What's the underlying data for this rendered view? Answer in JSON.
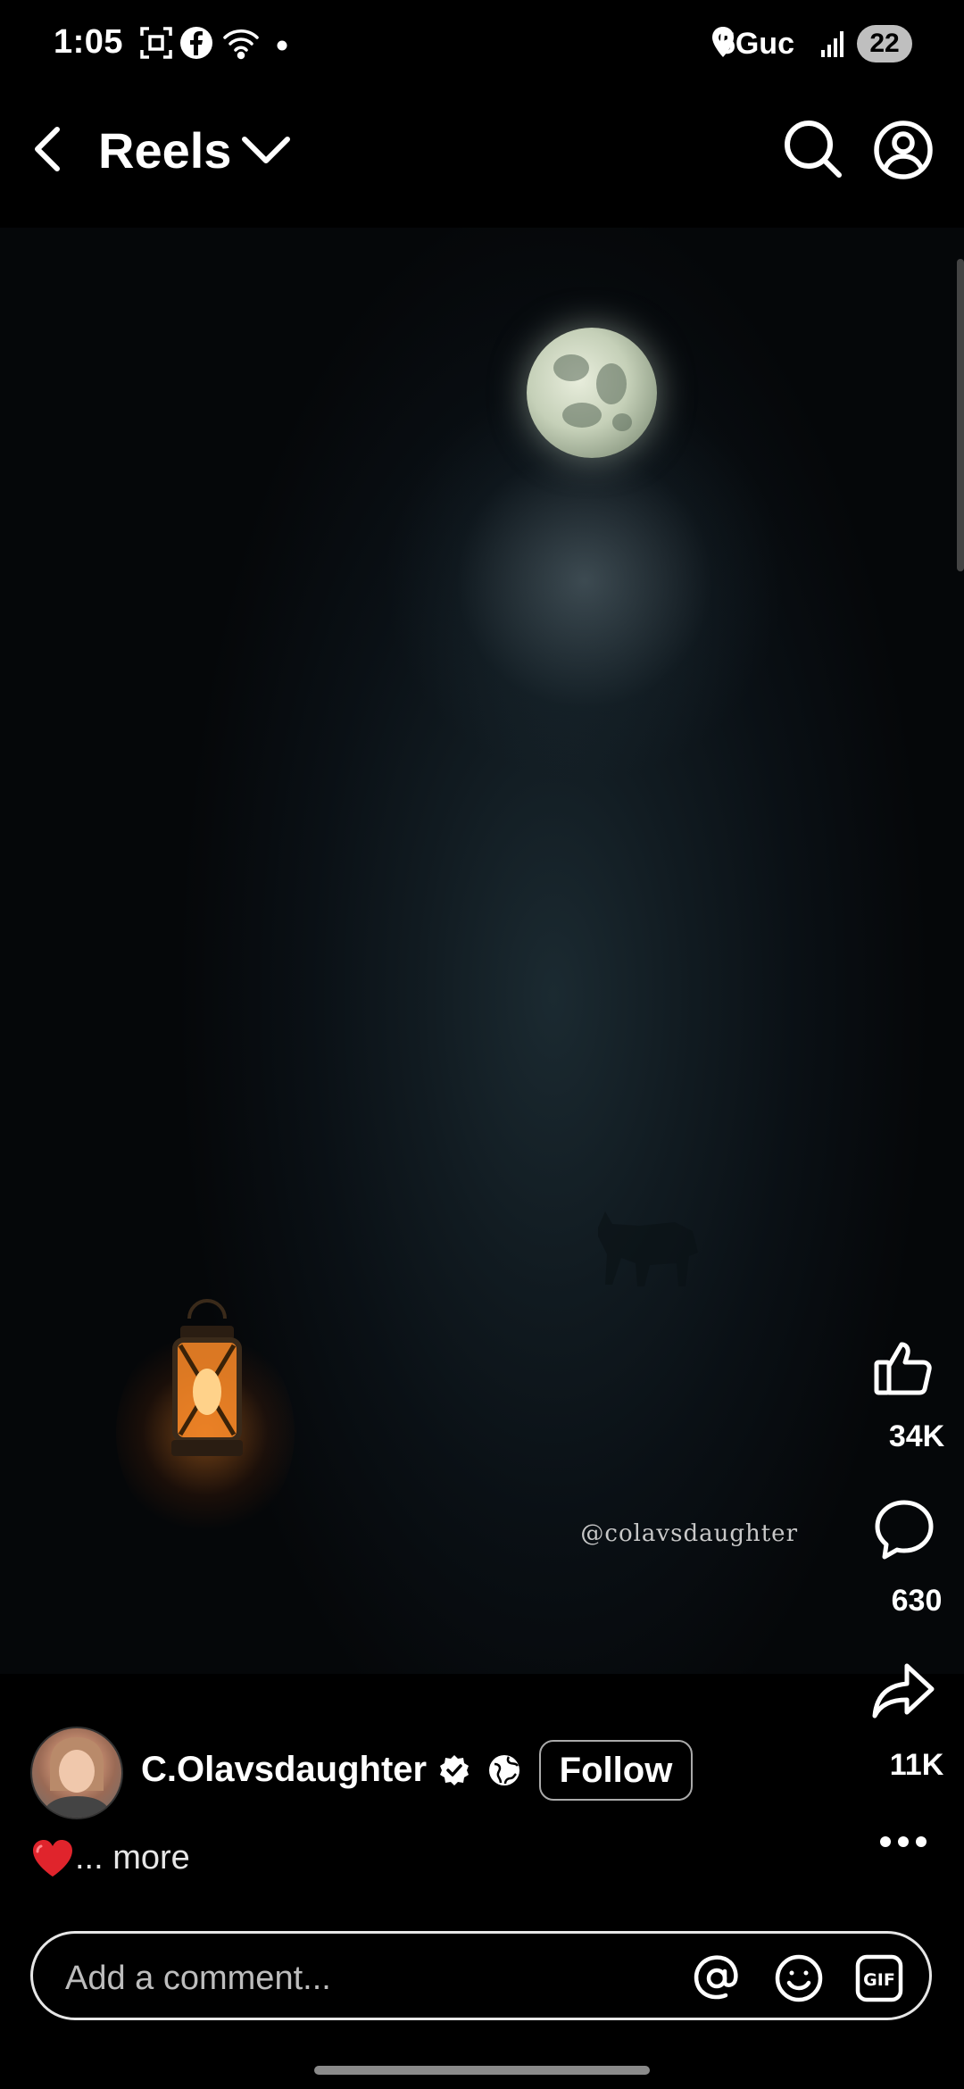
{
  "status_bar": {
    "time": "1:05",
    "network": "5Guc",
    "battery": "22",
    "icons": [
      "screenshot-icon",
      "facebook-icon",
      "wifi-icon",
      "dot-icon",
      "location-icon",
      "signal-icon"
    ]
  },
  "header": {
    "title": "Reels",
    "icons": [
      "back-arrow-icon",
      "chevron-down-icon",
      "search-icon",
      "profile-icon"
    ]
  },
  "video": {
    "watermark": "@colavsdaughter"
  },
  "actions": {
    "like_count": "34K",
    "comment_count": "630",
    "share_count": "11K"
  },
  "author": {
    "name": "C.Olavsdaughter",
    "follow_label": "Follow",
    "verified": true
  },
  "caption": {
    "emoji": "❤️",
    "more_label": "... more"
  },
  "comment": {
    "placeholder": "Add a comment..."
  },
  "colors": {
    "background": "#000000",
    "text": "#ffffff",
    "heart": "#e0242c",
    "lantern": "#ff8c28"
  }
}
